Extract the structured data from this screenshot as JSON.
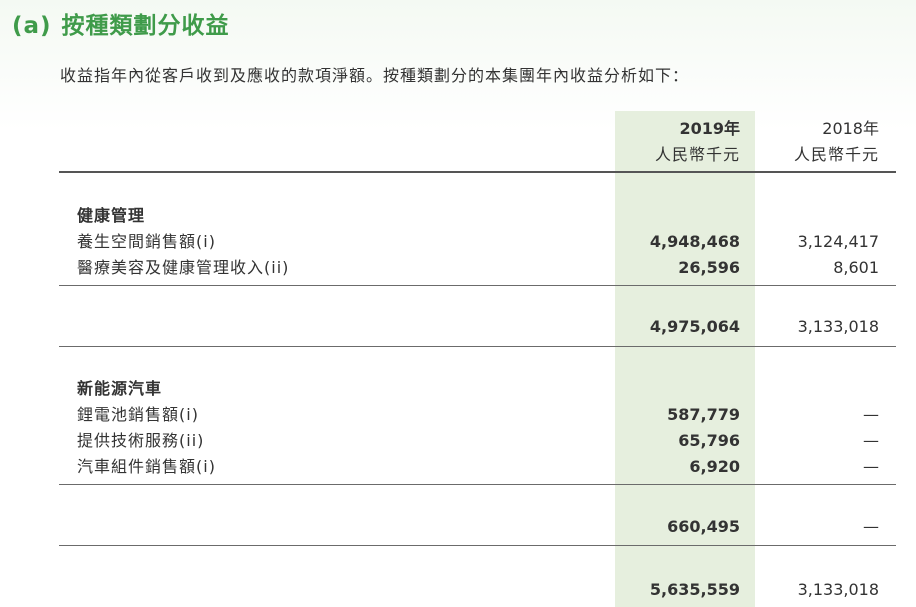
{
  "heading": {
    "label": "(a)",
    "title": "按種類劃分收益"
  },
  "intro": "收益指年內從客戶收到及應收的款項淨額。按種類劃分的本集團年內收益分析如下：",
  "columns": {
    "current": {
      "year": "2019年",
      "unit": "人民幣千元"
    },
    "prior": {
      "year": "2018年",
      "unit": "人民幣千元"
    }
  },
  "sections": [
    {
      "title": "健康管理",
      "rows": [
        {
          "label": "養生空間銷售額(i)",
          "v2019": "4,948,468",
          "v2018": "3,124,417"
        },
        {
          "label": "醫療美容及健康管理收入(ii)",
          "v2019": "26,596",
          "v2018": "8,601"
        }
      ],
      "subtotal": {
        "v2019": "4,975,064",
        "v2018": "3,133,018"
      }
    },
    {
      "title": "新能源汽車",
      "rows": [
        {
          "label": "鋰電池銷售額(i)",
          "v2019": "587,779",
          "v2018": "—"
        },
        {
          "label": "提供技術服務(ii)",
          "v2019": "65,796",
          "v2018": "—"
        },
        {
          "label": "汽車組件銷售額(i)",
          "v2019": "6,920",
          "v2018": "—"
        }
      ],
      "subtotal": {
        "v2019": "660,495",
        "v2018": "—"
      }
    }
  ],
  "total": {
    "v2019": "5,635,559",
    "v2018": "3,133,018"
  }
}
